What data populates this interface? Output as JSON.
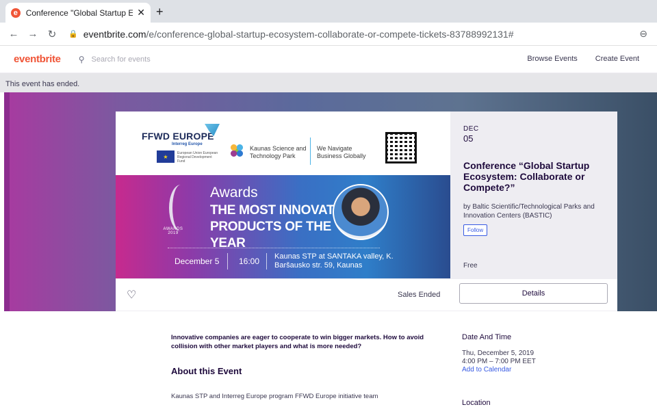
{
  "browser": {
    "tab_title": "Conference \"Global Startup Ecos",
    "favicon_letter": "e",
    "url_host": "eventbrite.com",
    "url_path": "/e/conference-global-startup-ecosystem-collaborate-or-compete-tickets-83788992131#"
  },
  "header": {
    "logo": "eventbrite",
    "search_placeholder": "Search for events",
    "nav": [
      "Browse Events",
      "Create Event"
    ]
  },
  "banner_notice": "This event has ended.",
  "event_image": {
    "ffwd": "FFWD EUROPE",
    "interreg": "Interreg Europe",
    "eu_text": "European Union European Regional Development Fund",
    "kstp": "Kaunas Science and Technology Park",
    "navigate": "We Navigate Business Globally",
    "trophy_label": "AWARDS 2019",
    "awards": "Awards",
    "awards_sub": "THE MOST INNOVATIVE PRODUCTS OF THE YEAR",
    "date": "December 5",
    "time": "16:00",
    "place": "Kaunas STP at SANTAKA valley, K. Baršausko str. 59, Kaunas"
  },
  "event": {
    "month": "DEC",
    "day": "05",
    "title": "Conference “Global Startup Ecosystem: Collaborate or Compete?”",
    "organizer": "by Baltic Scientific/Technological Parks and Innovation Centers (BASTIC)",
    "follow": "Follow",
    "price": "Free"
  },
  "actions": {
    "status": "Sales Ended",
    "details": "Details"
  },
  "content": {
    "lead": "Innovative companies are eager to cooperate to win bigger markets. How to avoid collision with other market players and what is more needed?",
    "about_heading": "About this Event",
    "description": "Kaunas STP and Interreg Europe program FFWD Europe initiative team",
    "date_heading": "Date And Time",
    "date_line1": "Thu, December 5, 2019",
    "date_line2": "4:00 PM – 7:00 PM EET",
    "add_calendar": "Add to Calendar",
    "location_heading": "Location"
  },
  "colors": {
    "brand": "#f05537",
    "link": "#3659e3",
    "text": "#1e0a3c"
  }
}
